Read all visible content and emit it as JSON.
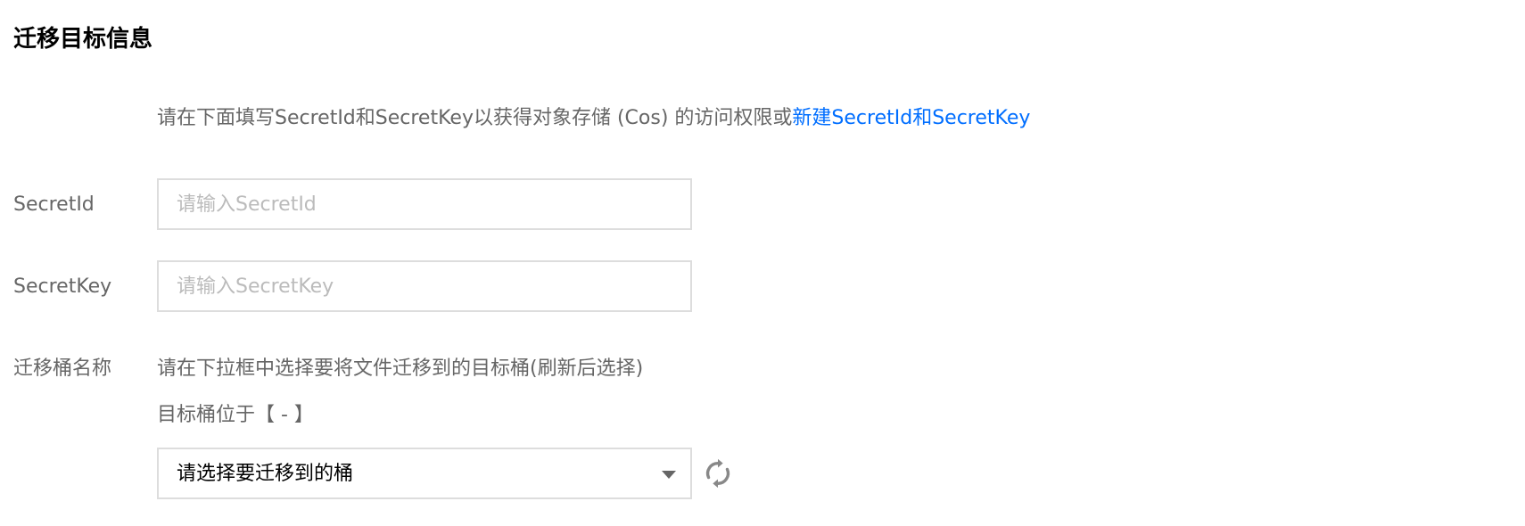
{
  "section_title": "迁移目标信息",
  "notice": {
    "text": "请在下面填写SecretId和SecretKey以获得对象存储 (Cos) 的访问权限或",
    "link": "新建SecretId和SecretKey"
  },
  "secret_id": {
    "label": "SecretId",
    "value": "",
    "placeholder": "请输入SecretId"
  },
  "secret_key": {
    "label": "SecretKey",
    "value": "",
    "placeholder": "请输入SecretKey"
  },
  "bucket": {
    "label": "迁移桶名称",
    "hint": "请在下拉框中选择要将文件迁移到的目标桶(刷新后选择)",
    "location": "目标桶位于【 - 】",
    "selected": "请选择要迁移到的桶",
    "dropdown_icon": "chevron-down-icon",
    "refresh_icon": "refresh-icon"
  },
  "colors": {
    "link": "#006eff",
    "label": "#666666",
    "border": "#dddddd",
    "placeholder": "#bbbbbb"
  }
}
